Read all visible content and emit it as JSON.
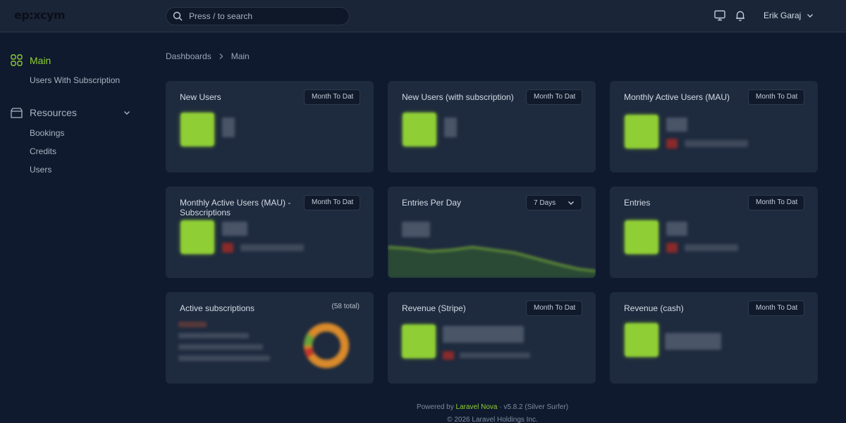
{
  "app": {
    "logo_text": "ep:xcym"
  },
  "search": {
    "placeholder": "Press / to search"
  },
  "user": {
    "name": "Erik Garaj"
  },
  "sidebar": {
    "main": {
      "label": "Main",
      "items": [
        "Users With Subscription"
      ]
    },
    "resources": {
      "label": "Resources",
      "items": [
        "Bookings",
        "Credits",
        "Users"
      ]
    }
  },
  "breadcrumb": {
    "root": "Dashboards",
    "current": "Main"
  },
  "cards": [
    {
      "title": "New Users",
      "range": "Month To Dat"
    },
    {
      "title": "New Users (with subscription)",
      "range": "Month To Dat"
    },
    {
      "title": "Monthly Active Users (MAU)",
      "range": "Month To Dat"
    },
    {
      "title": "Monthly Active Users (MAU) - Subscriptions",
      "range": "Month To Dat"
    },
    {
      "title": "Entries Per Day",
      "range": "7 Days"
    },
    {
      "title": "Entries",
      "range": "Month To Dat"
    },
    {
      "title": "Active subscriptions",
      "total": "(58 total)"
    },
    {
      "title": "Revenue (Stripe)",
      "range": "Month To Dat"
    },
    {
      "title": "Revenue (cash)",
      "range": "Month To Dat"
    }
  ],
  "footer": {
    "powered_prefix": "Powered by",
    "powered_brand": "Laravel Nova",
    "powered_suffix": "· v5.8.2 (Silver Surfer)",
    "copyright": "© 2026 Laravel Holdings Inc."
  },
  "colors": {
    "accent": "#8fce35",
    "background": "#0f1a2e",
    "card": "#1e2a3e",
    "topbar": "#1a2538"
  }
}
